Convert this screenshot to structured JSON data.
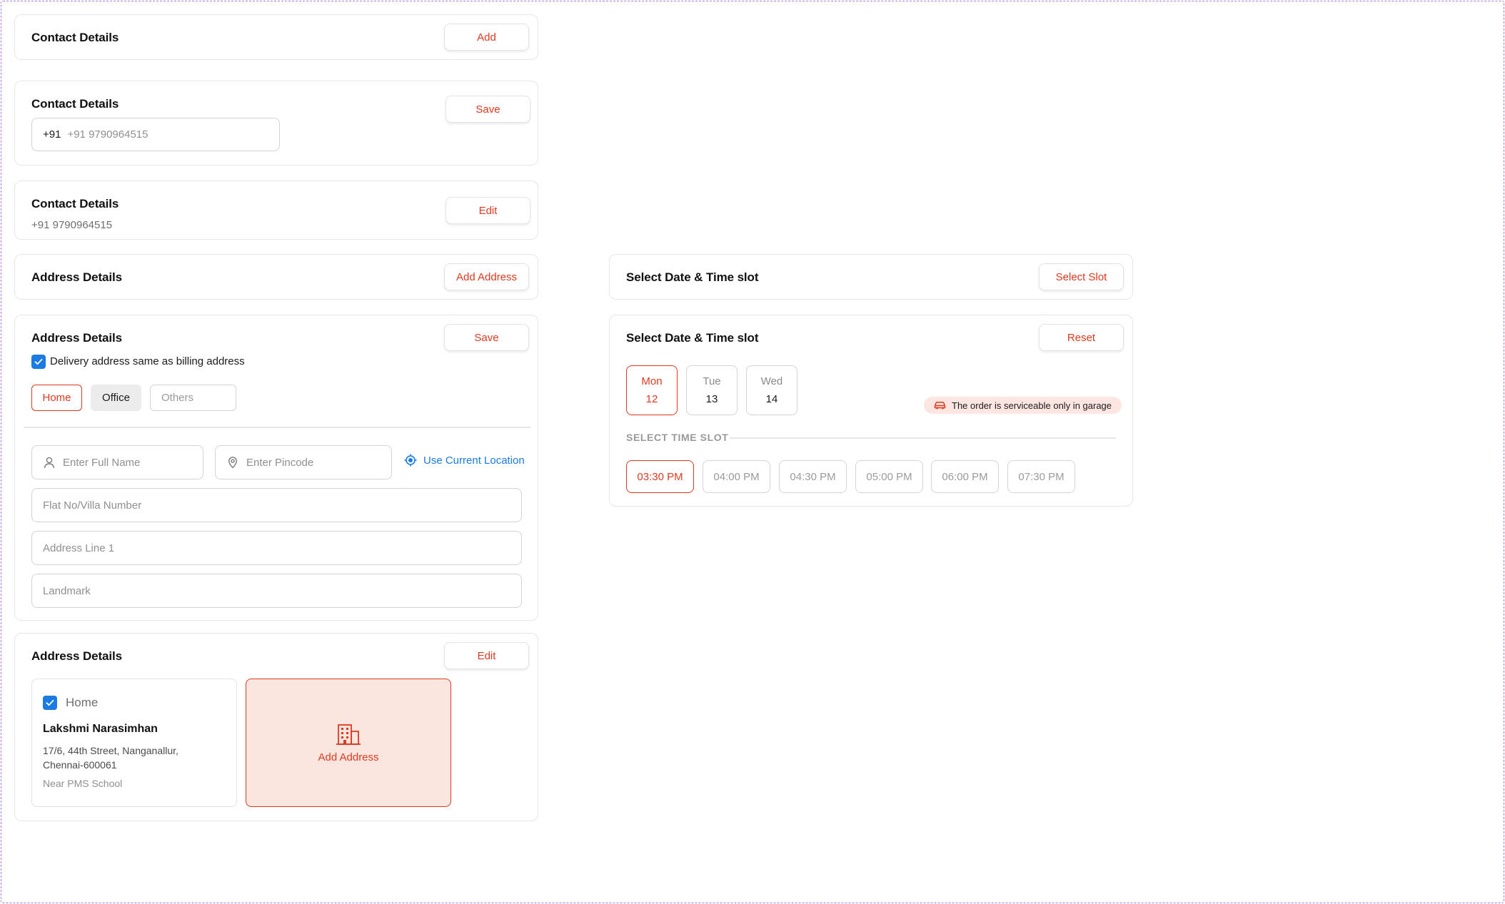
{
  "contact_add": {
    "title": "Contact Details",
    "button": "Add"
  },
  "contact_edit_form": {
    "title": "Contact Details",
    "button": "Save",
    "phone_prefix": "+91",
    "phone_placeholder": "+91 9790964515"
  },
  "contact_view": {
    "title": "Contact Details",
    "button": "Edit",
    "phone": "+91 9790964515"
  },
  "address_add": {
    "title": "Address Details",
    "button": "Add Address"
  },
  "address_form": {
    "title": "Address Details",
    "button": "Save",
    "same_billing_label": "Delivery address same as billing address",
    "same_billing_checked": true,
    "types": [
      "Home",
      "Office",
      "Others"
    ],
    "selected_type": "Home",
    "full_name_placeholder": "Enter Full Name",
    "pincode_placeholder": "Enter Pincode",
    "use_location_label": "Use Current Location",
    "flat_placeholder": "Flat No/Villa Number",
    "address_line_placeholder": "Address Line 1",
    "landmark_placeholder": "Landmark"
  },
  "address_view": {
    "title": "Address Details",
    "button": "Edit",
    "saved": {
      "type": "Home",
      "name": "Lakshmi Narasimhan",
      "line1": "17/6, 44th Street, Nanganallur,",
      "line2": "Chennai-600061",
      "landmark": "Near PMS School"
    },
    "add_tile_label": "Add Address"
  },
  "slot_select": {
    "title": "Select Date & Time slot",
    "button": "Select Slot"
  },
  "slot_picker": {
    "title": "Select Date & Time slot",
    "button": "Reset",
    "days": [
      {
        "day": "Mon",
        "date": "12"
      },
      {
        "day": "Tue",
        "date": "13"
      },
      {
        "day": "Wed",
        "date": "14"
      }
    ],
    "selected_day": "Mon",
    "notice": "The order is serviceable only in garage",
    "time_label": "SELECT TIME SLOT",
    "times": [
      "03:30 PM",
      "04:00 PM",
      "04:30 PM",
      "05:00 PM",
      "06:00 PM",
      "07:30 PM"
    ],
    "selected_time": "03:30 PM"
  },
  "colors": {
    "accent": "#e0391f",
    "checkbox": "#1c7be3",
    "link": "#1c7be3",
    "badge_bg": "#fde6e1",
    "tile_bg": "#fbe5df"
  }
}
